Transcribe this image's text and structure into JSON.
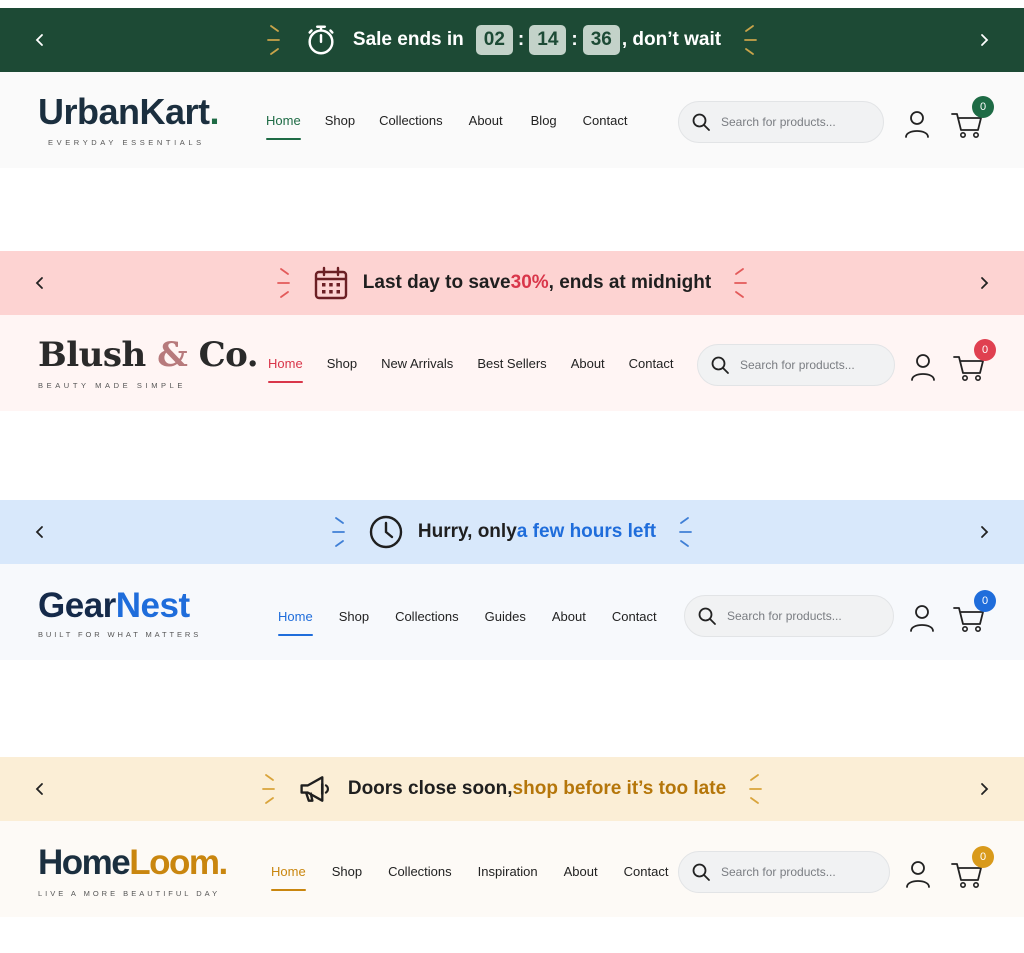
{
  "headers": [
    {
      "brand": {
        "name_a": "UrbanKart",
        "name_b": ".",
        "tagline": "EVERYDAY ESSENTIALS"
      },
      "banner": {
        "prefix": "Sale ends in",
        "hours": "02",
        "minutes": "14",
        "seconds": "36",
        "suffix": ", don’t wait",
        "icon": "stopwatch-icon"
      },
      "nav": [
        "Home",
        "Shop",
        "Collections",
        "About",
        "Blog",
        "Contact"
      ],
      "active_nav": "Home",
      "search": {
        "placeholder": "Search for products..."
      },
      "cart_count": "0",
      "colors": {
        "accent": "#1e6b45",
        "banner_bg": "#1d4a35",
        "header_bg": "#fafafa",
        "badge": "#1e6b45",
        "ray": "#c9a44a"
      }
    },
    {
      "brand": {
        "name_a": "Blush ",
        "name_amp": "&",
        "name_b": " Co.",
        "tagline": "BEAUTY MADE SIMPLE"
      },
      "banner": {
        "text_a": "Last day to save ",
        "highlight": "30%",
        "text_b": ", ends at midnight",
        "icon": "calendar-icon"
      },
      "nav": [
        "Home",
        "Shop",
        "New Arrivals",
        "Best Sellers",
        "About",
        "Contact"
      ],
      "active_nav": "Home",
      "search": {
        "placeholder": "Search for products..."
      },
      "cart_count": "0",
      "colors": {
        "accent": "#d9364a",
        "banner_bg": "#fdd3d2",
        "header_bg": "#fff5f4",
        "badge": "#e04050",
        "ray": "#e35a5a",
        "amp": "#b77a7c"
      }
    },
    {
      "brand": {
        "name_a": "Gear",
        "name_b": "Nest",
        "tagline": "BUILT FOR WHAT MATTERS"
      },
      "banner": {
        "text_a": "Hurry, only ",
        "highlight": "a few hours left",
        "icon": "clock-icon"
      },
      "nav": [
        "Home",
        "Shop",
        "Collections",
        "Guides",
        "About",
        "Contact"
      ],
      "active_nav": "Home",
      "search": {
        "placeholder": "Search for products..."
      },
      "cart_count": "0",
      "colors": {
        "accent": "#1f6ddb",
        "banner_bg": "#d8e8fb",
        "header_bg": "#f7f9fc",
        "badge": "#1f6ddb",
        "ray": "#3f7fd6"
      }
    },
    {
      "brand": {
        "name_a": "Home",
        "name_b": "Loom",
        "name_c": ".",
        "tagline": "LIVE A MORE BEAUTIFUL DAY"
      },
      "banner": {
        "text_a": "Doors close soon, ",
        "highlight": "shop before it’s too late",
        "icon": "megaphone-icon"
      },
      "nav": [
        "Home",
        "Shop",
        "Collections",
        "Inspiration",
        "About",
        "Contact"
      ],
      "active_nav": "Home",
      "search": {
        "placeholder": "Search for products..."
      },
      "cart_count": "0",
      "colors": {
        "accent": "#c9860f",
        "banner_bg": "#fbeed6",
        "header_bg": "#fdfaf6",
        "badge": "#d99a1b",
        "ray": "#d9a43b"
      }
    }
  ],
  "icons": {
    "prev": "chevron-left-icon",
    "next": "chevron-right-icon",
    "search": "search-icon",
    "user": "user-icon",
    "cart": "cart-icon"
  }
}
